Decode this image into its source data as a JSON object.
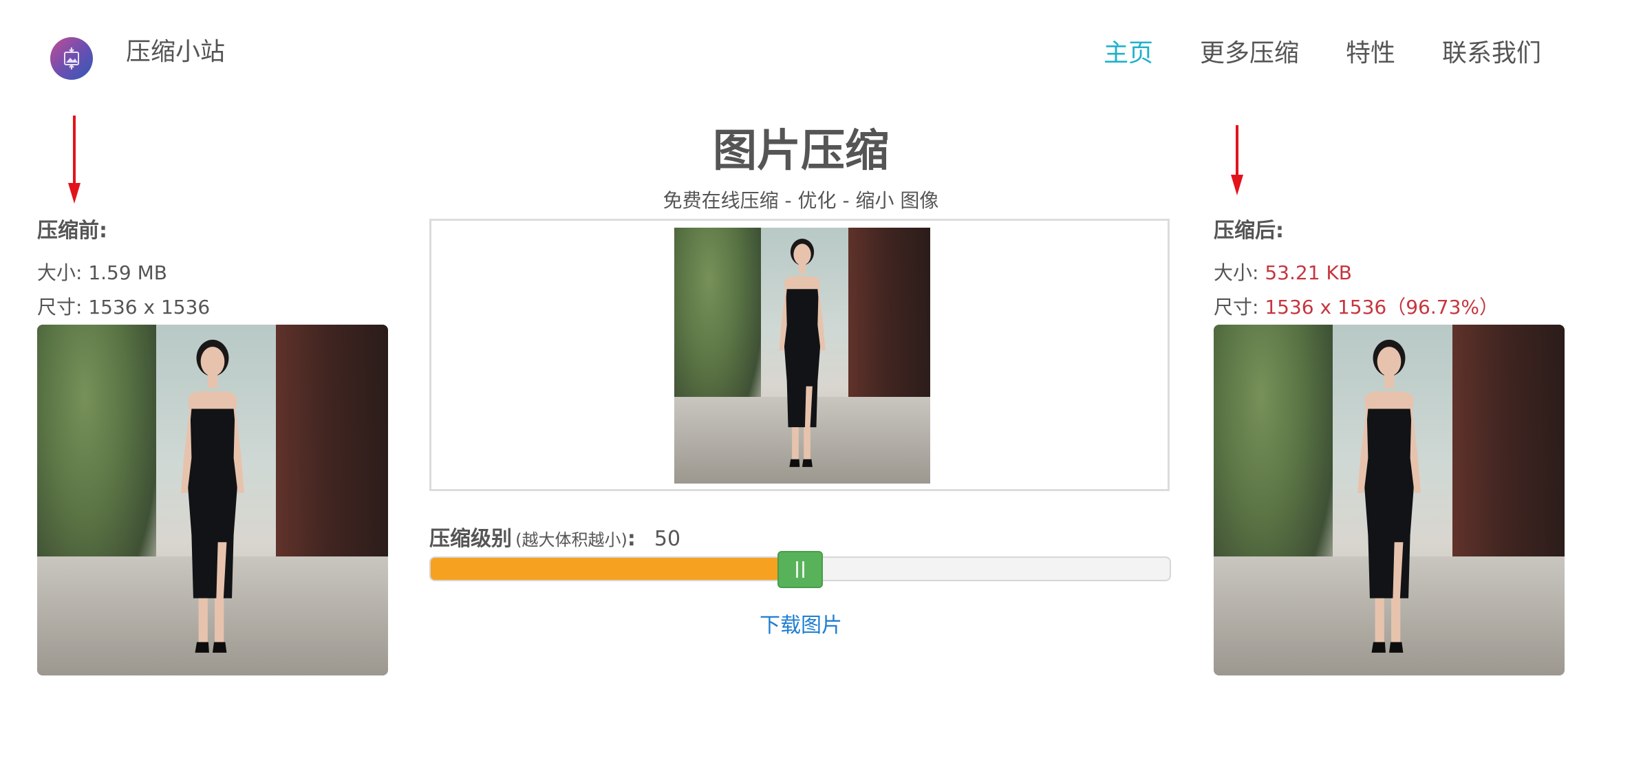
{
  "header": {
    "site_name": "压缩小站",
    "nav": [
      {
        "label": "主页",
        "active": true
      },
      {
        "label": "更多压缩",
        "active": false
      },
      {
        "label": "特性",
        "active": false
      },
      {
        "label": "联系我们",
        "active": false
      }
    ]
  },
  "main": {
    "title": "图片压缩",
    "subtitle": "免费在线压缩 - 优化 - 缩小 图像"
  },
  "before": {
    "label": "压缩前:",
    "size_label": "大小: ",
    "size_value": "1.59 MB",
    "dims_label": "尺寸: ",
    "dims_value": "1536 x 1536"
  },
  "after": {
    "label": "压缩后:",
    "size_label": "大小: ",
    "size_value": "53.21 KB",
    "dims_label": "尺寸: ",
    "dims_value": "1536 x 1536（96.73%）"
  },
  "compression": {
    "label": "压缩级别",
    "hint": "(越大体积越小)",
    "colon": ":",
    "value": "50",
    "level_fraction": 0.5
  },
  "actions": {
    "download_label": "下载图片"
  },
  "colors": {
    "accent_nav": "#1fb1cc",
    "slider_fill": "#f6a11f",
    "slider_handle": "#58b25a",
    "highlight_red": "#c5363f",
    "link_blue": "#1f7fd1",
    "arrow_red": "#e3131b"
  },
  "icons": {
    "logo": "image-compress-logo-icon",
    "arrow": "down-arrow-icon"
  }
}
